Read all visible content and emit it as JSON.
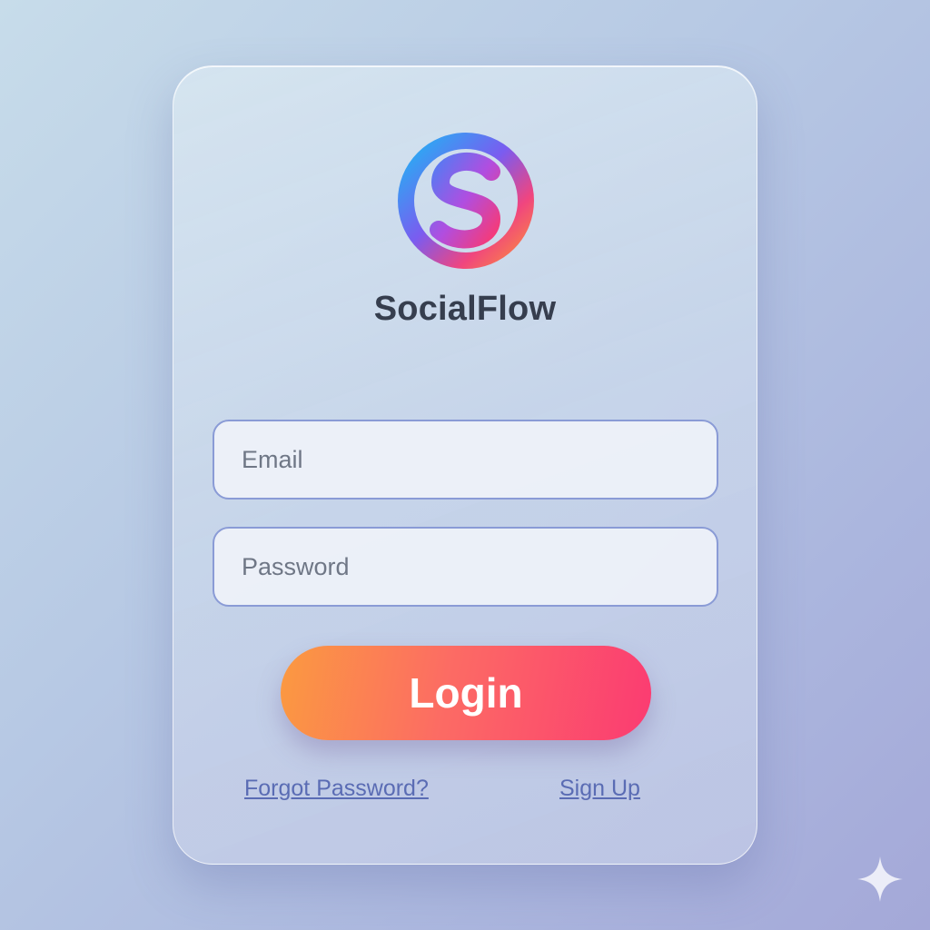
{
  "app": {
    "name": "SocialFlow",
    "logo_icon": "socialflow-s-logo-icon"
  },
  "form": {
    "email_placeholder": "Email",
    "password_placeholder": "Password",
    "login_label": "Login"
  },
  "links": {
    "forgot_password": "Forgot Password?",
    "sign_up": "Sign Up"
  },
  "colors": {
    "login_gradient_start": "#fb9a40",
    "login_gradient_end": "#fb3b72",
    "link": "#5a6cb4",
    "field_border": "#8a9bd6",
    "brand_text": "#363e4e"
  },
  "decor": {
    "corner_icon": "sparkle-icon"
  }
}
